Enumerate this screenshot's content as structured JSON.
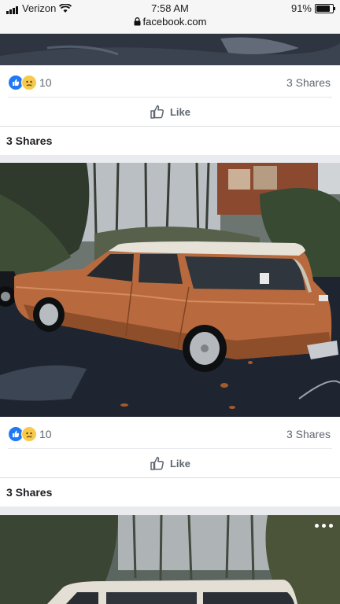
{
  "status_bar": {
    "carrier": "Verizon",
    "time": "7:58 AM",
    "url": "facebook.com",
    "battery": "91%"
  },
  "posts": [
    {
      "reaction_count": "10",
      "share_count": "3 Shares",
      "like_label": "Like",
      "shares_heading": "3 Shares"
    },
    {
      "reaction_count": "10",
      "share_count": "3 Shares",
      "like_label": "Like",
      "shares_heading": "3 Shares"
    }
  ],
  "icons": [
    "wifi-icon",
    "signal-icon",
    "battery-icon",
    "lock-icon",
    "like-reaction-icon",
    "sad-reaction-icon",
    "thumbs-up-icon",
    "more-options-icon"
  ],
  "colors": {
    "facebook_blue": "#2078f4",
    "car_body": "#b86a3e",
    "muted_text": "#606770"
  }
}
